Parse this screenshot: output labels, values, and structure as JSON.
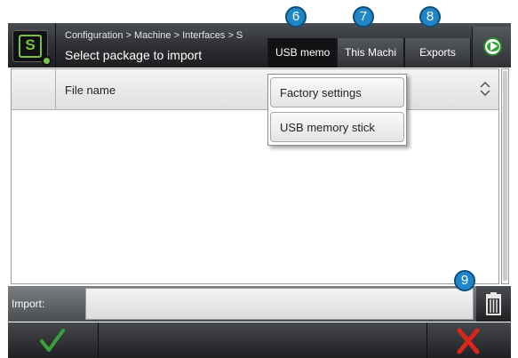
{
  "header": {
    "logo_text": "S",
    "breadcrumb": "Configuration > Machine > Interfaces > S",
    "subtitle": "Select package to import"
  },
  "tabs": [
    {
      "label": "USB memo",
      "active": true
    },
    {
      "label": "This Machi",
      "active": false
    },
    {
      "label": "Exports",
      "active": false
    }
  ],
  "badges": [
    "6",
    "7",
    "8",
    "9"
  ],
  "dropdown": {
    "items": [
      "Factory settings",
      "USB memory stick"
    ]
  },
  "table": {
    "columns": [
      "File name"
    ],
    "rows": []
  },
  "import": {
    "label": "Import:",
    "value": ""
  },
  "colors": {
    "accent_green": "#3aa03a",
    "cancel_red": "#d9261c",
    "badge_blue": "#1f86c8"
  },
  "icons": [
    "settings-logo-icon",
    "next-arrow-icon",
    "sort-icon",
    "trash-icon",
    "checkmark-icon",
    "cross-icon"
  ]
}
